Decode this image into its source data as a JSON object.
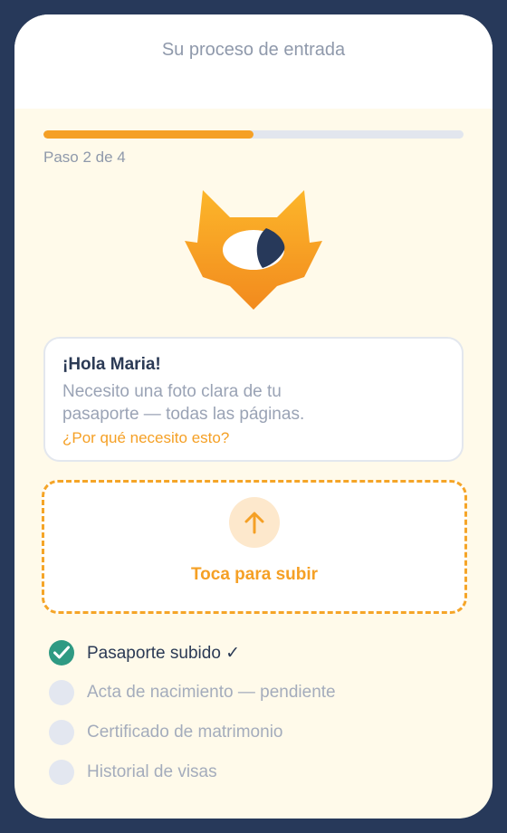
{
  "header": {
    "title": "Su proceso de entrada"
  },
  "progress": {
    "fraction": 0.5,
    "step_label": "Paso 2 de 4",
    "fill_color": "#f5a025"
  },
  "mascot": {
    "icon": "fox-mascot-icon"
  },
  "message": {
    "greeting": "¡Hola Maria!",
    "request": "Necesito una foto clara de tu pasaporte — todas las páginas.",
    "why_link": "¿Por qué necesito esto?"
  },
  "upload": {
    "label": "Toca para subir",
    "icon": "upload-arrow-icon"
  },
  "checklist": [
    {
      "label": "Pasaporte subido ✓",
      "done": true
    },
    {
      "label": "Acta de nacimiento — pendiente",
      "done": false
    },
    {
      "label": "Certificado de matrimonio",
      "done": false
    },
    {
      "label": "Historial de visas",
      "done": false
    }
  ],
  "colors": {
    "accent": "#f5a025",
    "success": "#2f9a83",
    "frame": "#27395a",
    "text": "#2b3a55"
  }
}
